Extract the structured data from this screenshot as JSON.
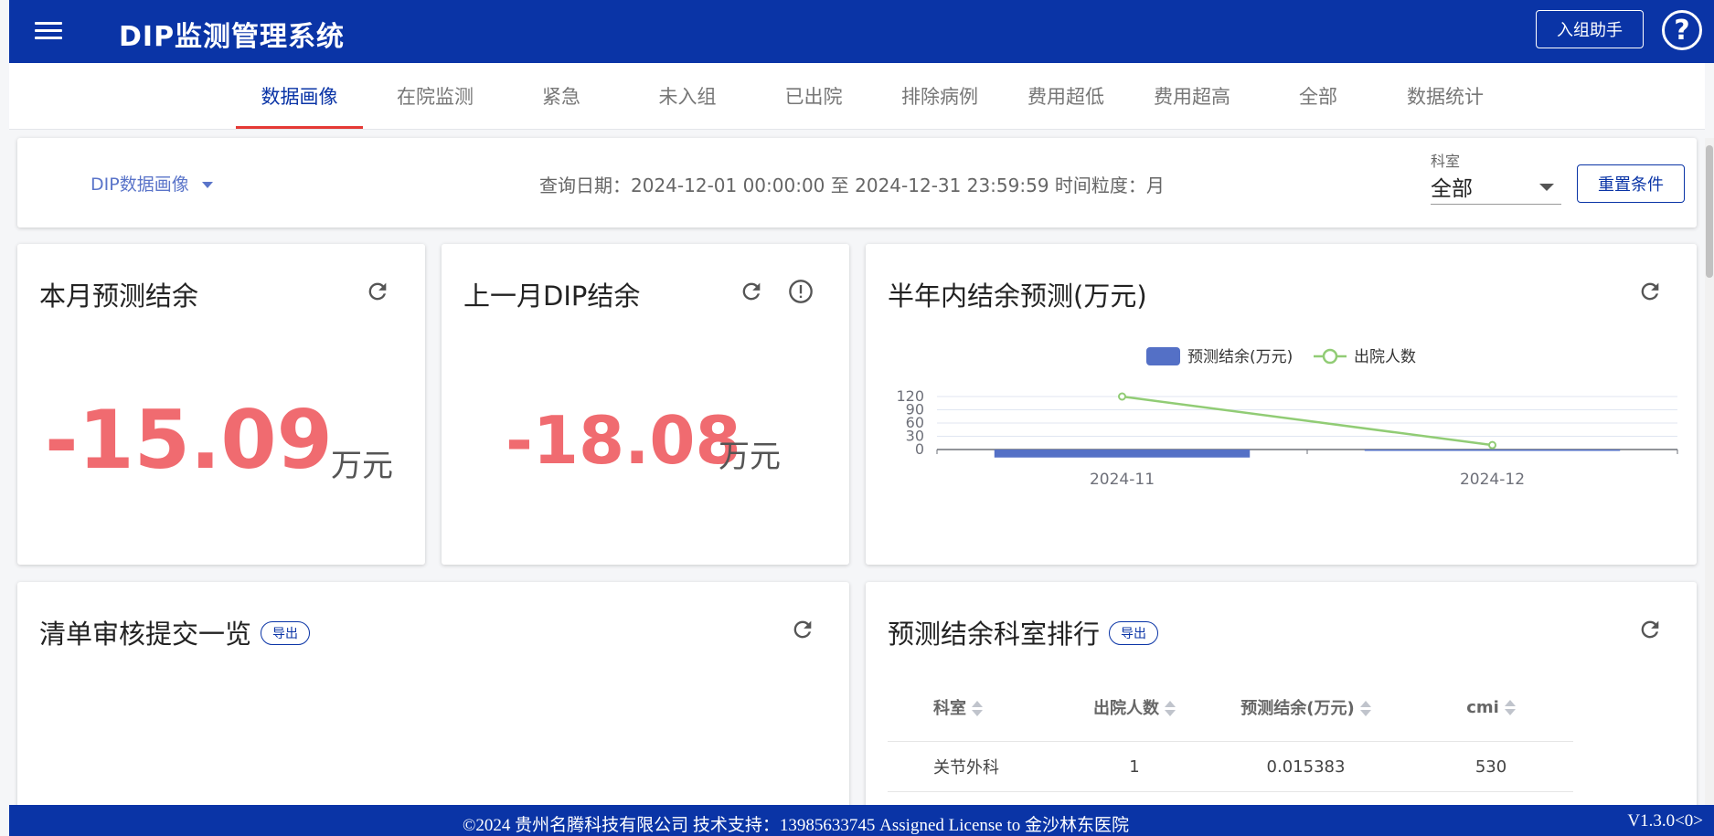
{
  "header": {
    "title": "DIP监测管理系统",
    "assistant_label": "入组助手",
    "help_glyph": "?"
  },
  "tabs": [
    {
      "label": "数据画像",
      "active": true
    },
    {
      "label": "在院监测"
    },
    {
      "label": "紧急"
    },
    {
      "label": "未入组"
    },
    {
      "label": "已出院"
    },
    {
      "label": "排除病例"
    },
    {
      "label": "费用超低"
    },
    {
      "label": "费用超高"
    },
    {
      "label": "全部"
    },
    {
      "label": "数据统计"
    }
  ],
  "filter": {
    "view_select": "DIP数据画像",
    "query_text": "查询日期：2024-12-01 00:00:00 至 2024-12-31 23:59:59 时间粒度：月",
    "dept_label": "科室",
    "dept_value": "全部",
    "reset_label": "重置条件"
  },
  "cards": {
    "month_forecast": {
      "title": "本月预测结余",
      "value": "-15.09",
      "unit": "万元"
    },
    "last_month": {
      "title": "上一月DIP结余",
      "value": "-18.08",
      "unit": "万元"
    },
    "half_year": {
      "title": "半年内结余预测(万元)"
    },
    "audit_list": {
      "title": "清单审核提交一览",
      "export_label": "导出"
    },
    "dept_rank": {
      "title": "预测结余科室排行",
      "export_label": "导出"
    }
  },
  "chart_data": {
    "type": "bar",
    "categories": [
      "2024-11",
      "2024-12"
    ],
    "series": [
      {
        "name": "预测结余(万元)",
        "type": "bar",
        "values": [
          -18.08,
          -0.5
        ],
        "color": "#5470c6"
      },
      {
        "name": "出院人数",
        "type": "line",
        "values": [
          120,
          10
        ],
        "color": "#91cc75"
      }
    ],
    "yticks": [
      0,
      30,
      60,
      90,
      120
    ],
    "ylim": [
      -30,
      150
    ],
    "legend": "top-center",
    "grid": true
  },
  "rank_table": {
    "columns": [
      "科室",
      "出院人数",
      "预测结余(万元)",
      "cmi"
    ],
    "rows": [
      [
        "关节外科",
        "1",
        "0.015383",
        "530"
      ]
    ]
  },
  "footer": {
    "copyright": "©2024 贵州名腾科技有限公司 技术支持：13985633745 Assigned License to 金沙林东医院",
    "version": "V1.3.0<0>"
  }
}
